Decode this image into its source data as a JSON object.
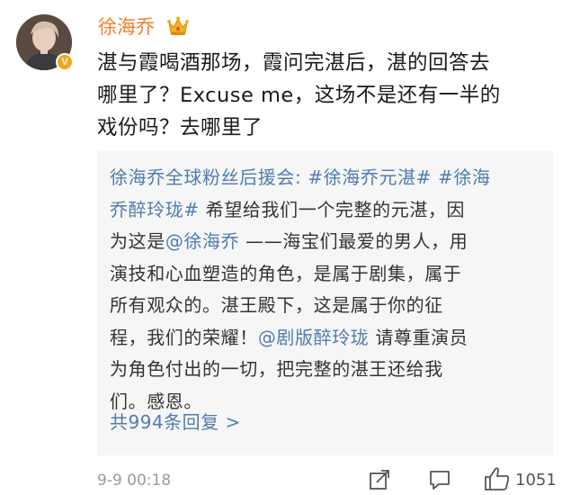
{
  "user": {
    "name": "徐海乔",
    "verified_badge": "V",
    "avatar_icon": "user-avatar",
    "crown_icon": "crown-icon",
    "accent_color": "#f07f2a"
  },
  "post": {
    "lines": [
      "湛与霞喝酒那场，霞问完湛后，湛的回答去",
      "哪里了？Excuse me，这场不是还有一半的",
      "戏份吗？去哪里了"
    ]
  },
  "quote": {
    "lines": [
      [
        {
          "t": "徐海乔全球粉丝后援会:",
          "link": true
        },
        {
          "t": " ",
          "link": false
        },
        {
          "t": "#徐海乔元湛#",
          "link": true
        },
        {
          "t": " ",
          "link": false
        },
        {
          "t": "#徐海",
          "link": true
        }
      ],
      [
        {
          "t": "乔醉玲珑#",
          "link": true
        },
        {
          "t": " 希望给我们一个完整的元湛，因",
          "link": false
        }
      ],
      [
        {
          "t": "为这是",
          "link": false
        },
        {
          "t": "@徐海乔",
          "link": true
        },
        {
          "t": " ——海宝们最爱的男人，用",
          "link": false
        }
      ],
      [
        {
          "t": "演技和心血塑造的角色，是属于剧集，属于",
          "link": false
        }
      ],
      [
        {
          "t": "所有观众的。湛王殿下，这是属于你的征",
          "link": false
        }
      ],
      [
        {
          "t": "程，我们的荣耀！",
          "link": false
        },
        {
          "t": "@剧版醉玲珑",
          "link": true
        },
        {
          "t": " 请尊重演员",
          "link": false
        }
      ],
      [
        {
          "t": "为角色付出的一切，把完整的湛王还给我",
          "link": false
        }
      ],
      [
        {
          "t": "们。感恩。",
          "link": false
        }
      ]
    ],
    "replies_label": "共994条回复 >",
    "link_color": "#4f7cae"
  },
  "footer": {
    "time": "9-9 00:18",
    "share_icon": "share-icon",
    "comment_icon": "comment-icon",
    "like_icon": "thumbs-up-icon",
    "like_count": "1051"
  }
}
